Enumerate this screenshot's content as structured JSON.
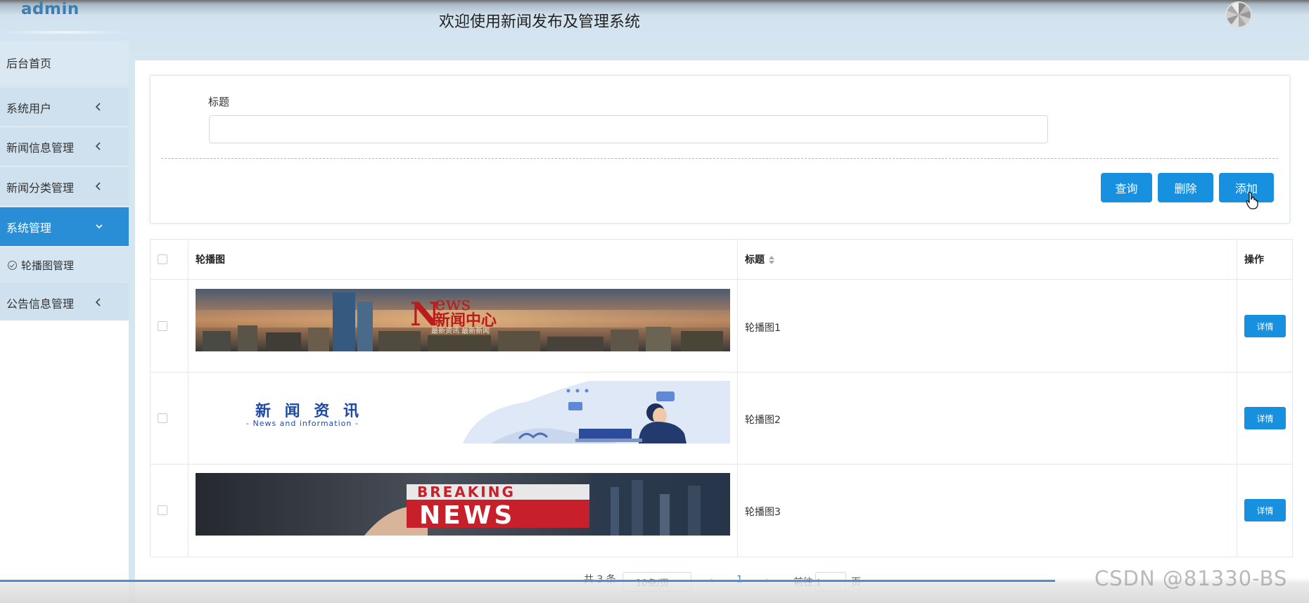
{
  "app": {
    "brand": "admin",
    "title": "欢迎使用新闻发布及管理系统"
  },
  "sidebar": {
    "home": "后台首页",
    "items": [
      {
        "label": "系统用户",
        "chevron": "chevron-left-icon"
      },
      {
        "label": "新闻信息管理",
        "chevron": "chevron-left-icon"
      },
      {
        "label": "新闻分类管理",
        "chevron": "chevron-left-icon"
      },
      {
        "label": "系统管理",
        "chevron": "chevron-down-icon",
        "active": true
      },
      {
        "label": "公告信息管理",
        "chevron": "chevron-left-icon"
      }
    ],
    "sub_item": "轮播图管理"
  },
  "search": {
    "label": "标题",
    "value": "",
    "placeholder": ""
  },
  "buttons": {
    "query": "查询",
    "delete": "删除",
    "add": "添加"
  },
  "table": {
    "headers": {
      "image": "轮播图",
      "title": "标题",
      "actions": "操作"
    },
    "rows": [
      {
        "image_alt": "News 新闻中心",
        "title": "轮播图1",
        "detail": "详情"
      },
      {
        "image_alt": "新闻资讯 News and information",
        "title": "轮播图2",
        "detail": "详情"
      },
      {
        "image_alt": "BREAKING NEWS",
        "title": "轮播图3",
        "detail": "详情"
      }
    ]
  },
  "pagination": {
    "total": "共 3 条",
    "page_size": "10条/页",
    "prev": "‹",
    "current": "1",
    "next": "›",
    "goto": "前往",
    "goto_value": "1",
    "page_suffix": "页"
  },
  "banner_text": {
    "news_big": "N",
    "news_small": "ews",
    "news_cn": "新闻中心",
    "news_sub": "最新资讯 最新新闻",
    "info_cn": "新 闻 资 讯",
    "info_en": "- News and information -",
    "breaking_top": "BREAKING",
    "breaking_bottom": "NEWS"
  },
  "watermark": "CSDN @81330-BS",
  "colors": {
    "accent": "#1890e0",
    "sidebar_active": "#2a8ed7",
    "sidebar_bg": "#cfe1ee",
    "background": "#d6e6f1"
  }
}
